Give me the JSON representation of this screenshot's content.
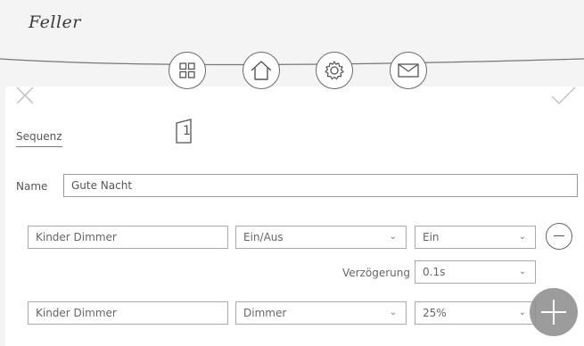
{
  "header": {
    "logo": "Feller",
    "nav_icons": [
      "grid-icon",
      "home-icon",
      "settings-icon",
      "mail-icon"
    ]
  },
  "toolbar": {
    "close_icon": "close-icon",
    "confirm_icon": "check-icon"
  },
  "tabs": {
    "active": "Sequenz",
    "page_number": "1"
  },
  "form": {
    "name_label": "Name",
    "name_value": "Gute Nacht"
  },
  "rows": [
    {
      "device": "Kinder Dimmer",
      "type": "Ein/Aus",
      "value": "Ein"
    },
    {
      "device": "Kinder Dimmer",
      "type": "Dimmer",
      "value": "25%"
    }
  ],
  "delay": {
    "label": "Verzögerung",
    "value": "0.1s"
  }
}
